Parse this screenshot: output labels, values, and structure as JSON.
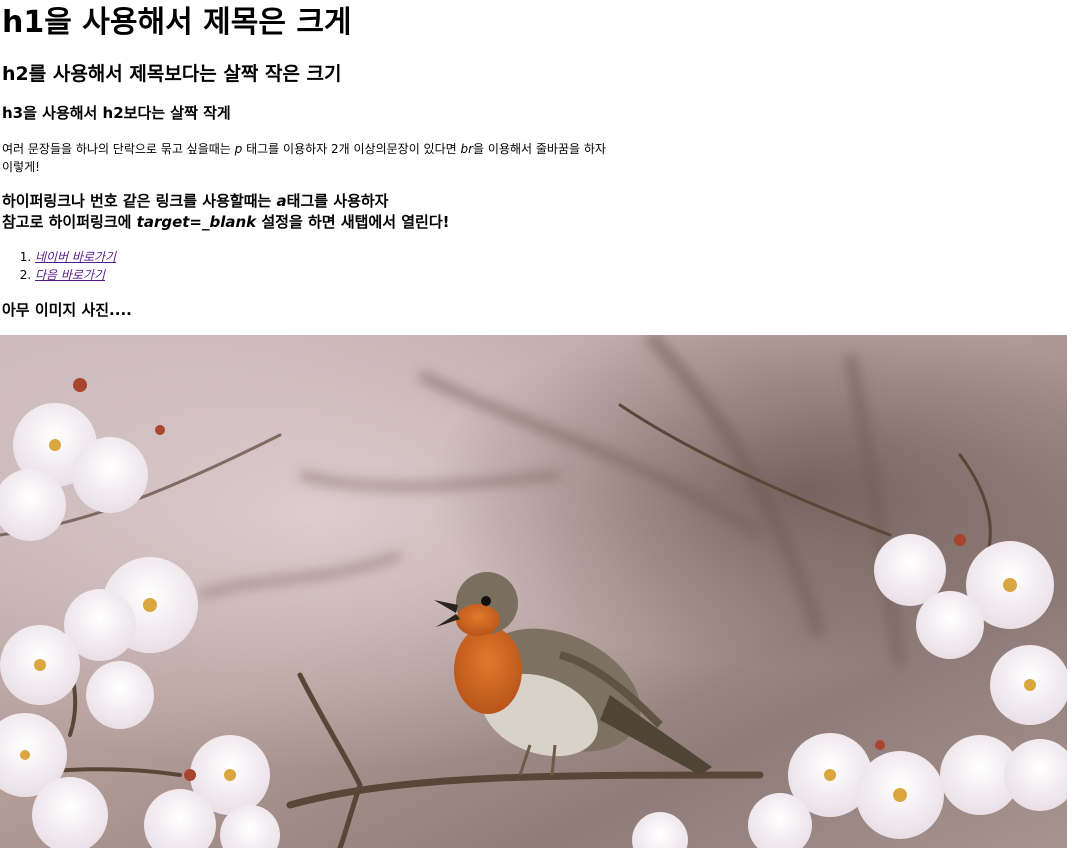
{
  "h1": "h1을 사용해서 제목은 크게",
  "h2": "h2를 사용해서 제목보다는 살짝 작은 크기",
  "h3": "h3을 사용해서 h2보다는 살짝 작게",
  "paragraph": {
    "text1": "여러 문장들을 하나의 단락으로 묶고 싶을때는 ",
    "p_tag": "p",
    "text2": " 태그를 이용하자 2개 이상의문장이 있다면 ",
    "br_tag": "br",
    "text3": "을 이용해서 줄바꿈을 하자",
    "line2": "이렇게!"
  },
  "links_heading": {
    "line1_pre": "하이퍼링크나 번호 같은 링크를 사용할때는 ",
    "a_tag": "a",
    "line1_post": "태그를 사용하자",
    "line2_pre": "참고로 하이퍼링크에 ",
    "target": "target=_blank",
    "line2_post": " 설정을 하면 새탭에서 열린다!"
  },
  "links": [
    {
      "label": "네이버 바로가기"
    },
    {
      "label": "다음 바로가기"
    }
  ],
  "image_heading": "아무 이미지 사진....",
  "colors": {
    "visited_link": "#551a8b"
  }
}
